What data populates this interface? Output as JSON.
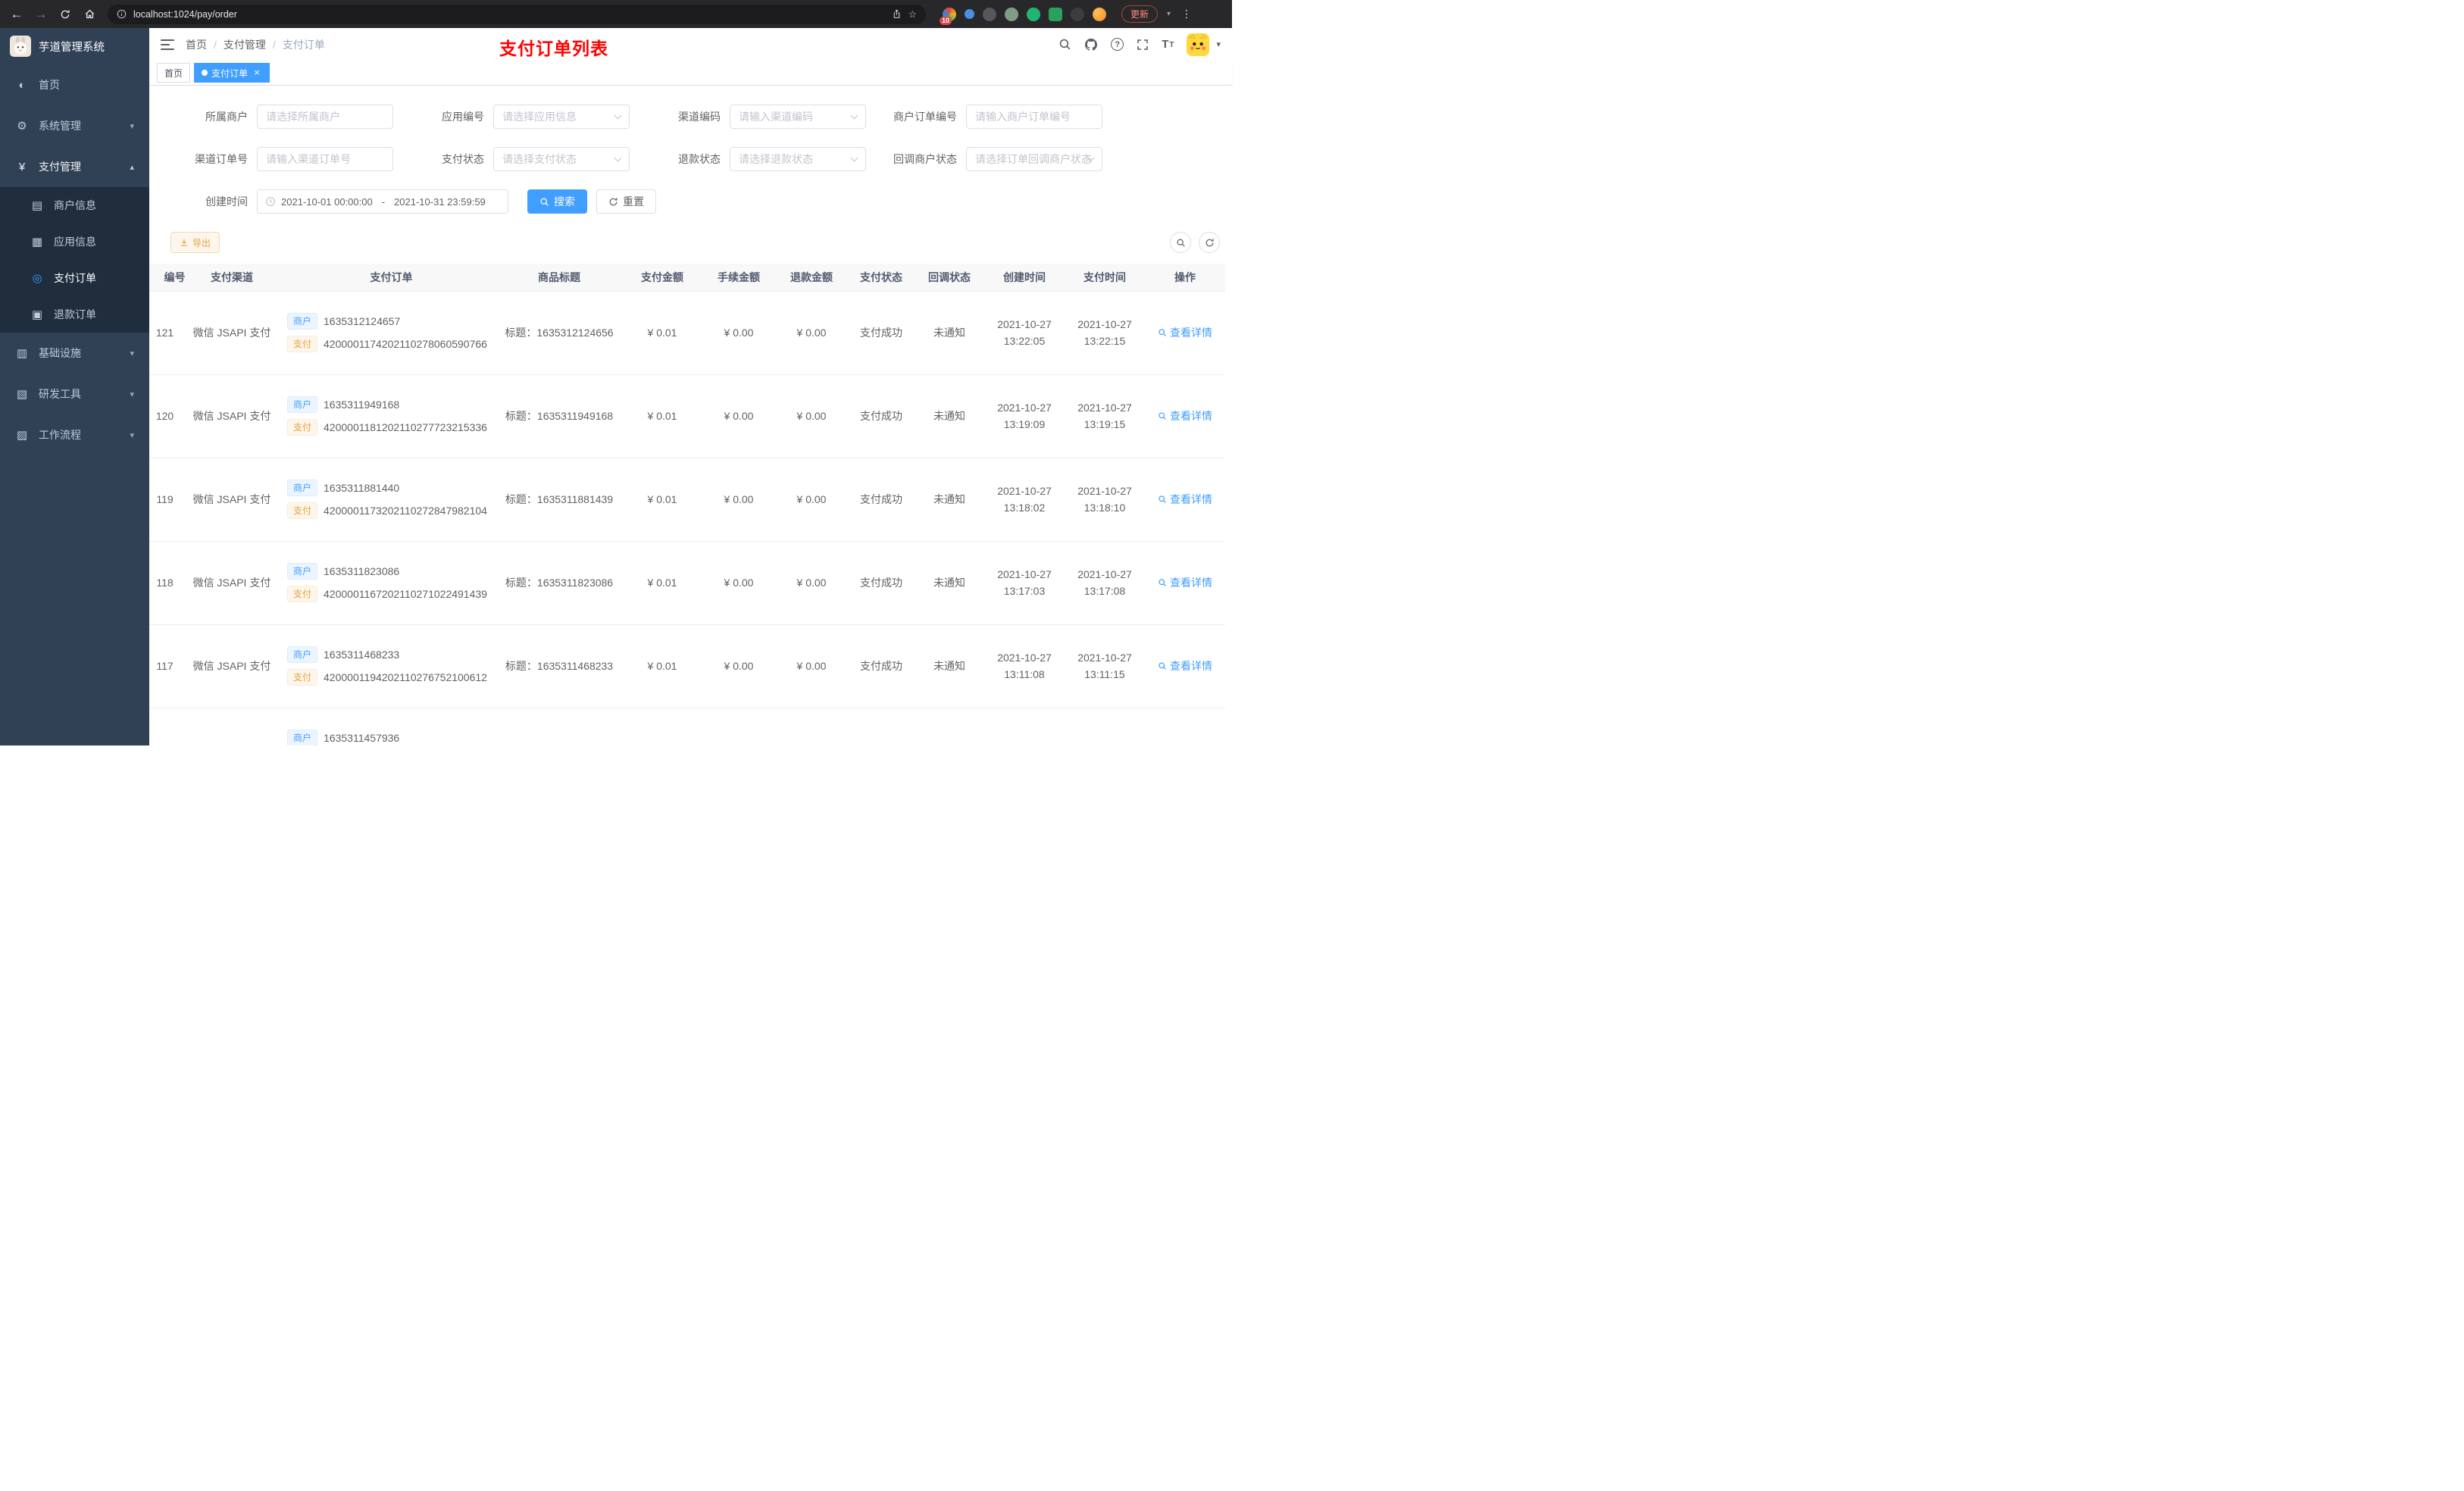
{
  "browser": {
    "url": "localhost:1024/pay/order",
    "update_label": "更新",
    "extension_badge": "10"
  },
  "icons": {
    "back": "←",
    "forward": "→",
    "star": "☆",
    "kebab": "⋮",
    "help": "?",
    "caret_down": "▾",
    "close": "×",
    "font_size": "T"
  },
  "sidebar": {
    "logo_title": "芋道管理系统",
    "menu": [
      {
        "icon": "◐",
        "label": "首页",
        "chevron": ""
      },
      {
        "icon": "⚙",
        "label": "系统管理",
        "chevron": "▾"
      },
      {
        "icon": "¥",
        "label": "支付管理",
        "chevron": "▴"
      },
      {
        "icon": "▤",
        "label": "商户信息",
        "chevron": ""
      },
      {
        "icon": "▦",
        "label": "应用信息",
        "chevron": ""
      },
      {
        "icon": "◎",
        "label": "支付订单",
        "chevron": ""
      },
      {
        "icon": "▣",
        "label": "退款订单",
        "chevron": ""
      },
      {
        "icon": "▥",
        "label": "基础设施",
        "chevron": "▾"
      },
      {
        "icon": "▧",
        "label": "研发工具",
        "chevron": "▾"
      },
      {
        "icon": "▨",
        "label": "工作流程",
        "chevron": "▾"
      }
    ]
  },
  "header": {
    "breadcrumb": [
      "首页",
      "支付管理",
      "支付订单"
    ],
    "separator": "/",
    "title": "支付订单列表"
  },
  "tabs": {
    "first": "首页",
    "active": "支付订单"
  },
  "filters": {
    "merchant": {
      "label": "所属商户",
      "placeholder": "请选择所属商户"
    },
    "app": {
      "label": "应用编号",
      "placeholder": "请选择应用信息"
    },
    "channel_code": {
      "label": "渠道编码",
      "placeholder": "请输入渠道编码"
    },
    "merchant_order_no": {
      "label": "商户订单编号",
      "placeholder": "请输入商户订单编号"
    },
    "channel_order_no": {
      "label": "渠道订单号",
      "placeholder": "请输入渠道订单号"
    },
    "pay_status": {
      "label": "支付状态",
      "placeholder": "请选择支付状态"
    },
    "refund_status": {
      "label": "退款状态",
      "placeholder": "请选择退款状态"
    },
    "notify_status": {
      "label": "回调商户状态",
      "placeholder": "请选择订单回调商户状态"
    },
    "create_time": {
      "label": "创建时间",
      "start": "2021-10-01 00:00:00",
      "separator": "-",
      "end": "2021-10-31 23:59:59"
    },
    "search": "搜索",
    "reset": "重置"
  },
  "toolbar": {
    "export": "导出"
  },
  "table": {
    "columns": [
      "编号",
      "支付渠道",
      "支付订单",
      "商品标题",
      "支付金额",
      "手续金额",
      "退款金额",
      "支付状态",
      "回调状态",
      "创建时间",
      "支付时间",
      "操作"
    ],
    "merchant_tag": "商户",
    "pay_tag": "支付",
    "action": "查看详情",
    "rows": [
      {
        "id": "121",
        "channel": "微信 JSAPI 支付",
        "merchant_no": "1635312124657",
        "pay_no": "4200001174202110278060590766",
        "title": "标题：1635312124656",
        "amount": "¥ 0.01",
        "fee": "¥ 0.00",
        "refund": "¥ 0.00",
        "status": "支付成功",
        "notify": "未通知",
        "created_date": "2021-10-27",
        "created_time": "13:22:05",
        "paid_date": "2021-10-27",
        "paid_time": "13:22:15"
      },
      {
        "id": "120",
        "channel": "微信 JSAPI 支付",
        "merchant_no": "1635311949168",
        "pay_no": "4200001181202110277723215336",
        "title": "标题：1635311949168",
        "amount": "¥ 0.01",
        "fee": "¥ 0.00",
        "refund": "¥ 0.00",
        "status": "支付成功",
        "notify": "未通知",
        "created_date": "2021-10-27",
        "created_time": "13:19:09",
        "paid_date": "2021-10-27",
        "paid_time": "13:19:15"
      },
      {
        "id": "119",
        "channel": "微信 JSAPI 支付",
        "merchant_no": "1635311881440",
        "pay_no": "4200001173202110272847982104",
        "title": "标题：1635311881439",
        "amount": "¥ 0.01",
        "fee": "¥ 0.00",
        "refund": "¥ 0.00",
        "status": "支付成功",
        "notify": "未通知",
        "created_date": "2021-10-27",
        "created_time": "13:18:02",
        "paid_date": "2021-10-27",
        "paid_time": "13:18:10"
      },
      {
        "id": "118",
        "channel": "微信 JSAPI 支付",
        "merchant_no": "1635311823086",
        "pay_no": "4200001167202110271022491439",
        "title": "标题：1635311823086",
        "amount": "¥ 0.01",
        "fee": "¥ 0.00",
        "refund": "¥ 0.00",
        "status": "支付成功",
        "notify": "未通知",
        "created_date": "2021-10-27",
        "created_time": "13:17:03",
        "paid_date": "2021-10-27",
        "paid_time": "13:17:08"
      },
      {
        "id": "117",
        "channel": "微信 JSAPI 支付",
        "merchant_no": "1635311468233",
        "pay_no": "4200001194202110276752100612",
        "title": "标题：1635311468233",
        "amount": "¥ 0.01",
        "fee": "¥ 0.00",
        "refund": "¥ 0.00",
        "status": "支付成功",
        "notify": "未通知",
        "created_date": "2021-10-27",
        "created_time": "13:11:08",
        "paid_date": "2021-10-27",
        "paid_time": "13:11:15"
      },
      {
        "merchant_no": "1635311457936"
      }
    ]
  }
}
